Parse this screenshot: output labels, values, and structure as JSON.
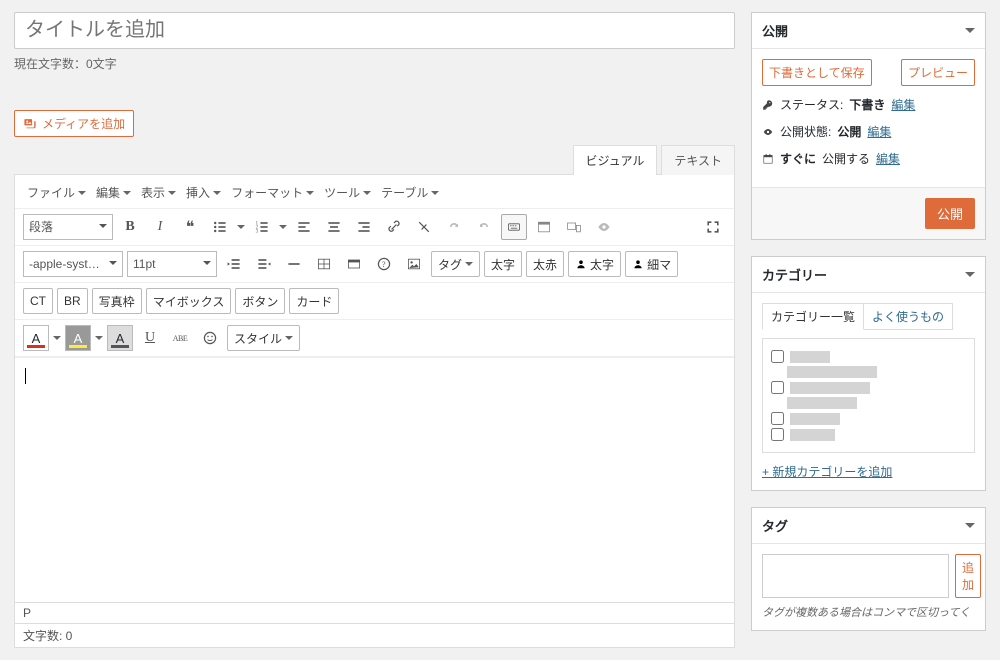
{
  "title_placeholder": "タイトルを追加",
  "char_count_top": "現在文字数：0文字",
  "add_media": "メディアを追加",
  "editor_tabs": {
    "visual": "ビジュアル",
    "text": "テキスト"
  },
  "menubar": [
    "ファイル",
    "編集",
    "表示",
    "挿入",
    "フォーマット",
    "ツール",
    "テーブル"
  ],
  "format_select": "段落",
  "font_family": "-apple-syst…",
  "font_size": "11pt",
  "tag_label": "タグ",
  "txt_btns_r2": [
    "太字",
    "太赤"
  ],
  "outline_btns_r2": [
    "太字",
    "細マ"
  ],
  "txt_btns_r3": [
    "CT",
    "BR",
    "写真枠",
    "マイボックス",
    "ボタン",
    "カード"
  ],
  "style_label": "スタイル",
  "char_label_a": "A",
  "u_label": "U",
  "abe_label": "ABE",
  "path": "P",
  "char_count_bottom": "文字数: 0",
  "publish": {
    "title": "公開",
    "save_draft": "下書きとして保存",
    "preview": "プレビュー",
    "status_label": "ステータス:",
    "status_value": "下書き",
    "visibility_label": "公開状態:",
    "visibility_value": "公開",
    "schedule_prefix": "すぐに",
    "schedule_suffix": "公開する",
    "edit": "編集",
    "publish_btn": "公開"
  },
  "categories": {
    "title": "カテゴリー",
    "tab_all": "カテゴリー一覧",
    "tab_freq": "よく使うもの",
    "add_new": "+ 新規カテゴリーを追加"
  },
  "tags": {
    "title": "タグ",
    "add": "追加",
    "hint": "タグが複数ある場合はコンマで区切ってく"
  }
}
